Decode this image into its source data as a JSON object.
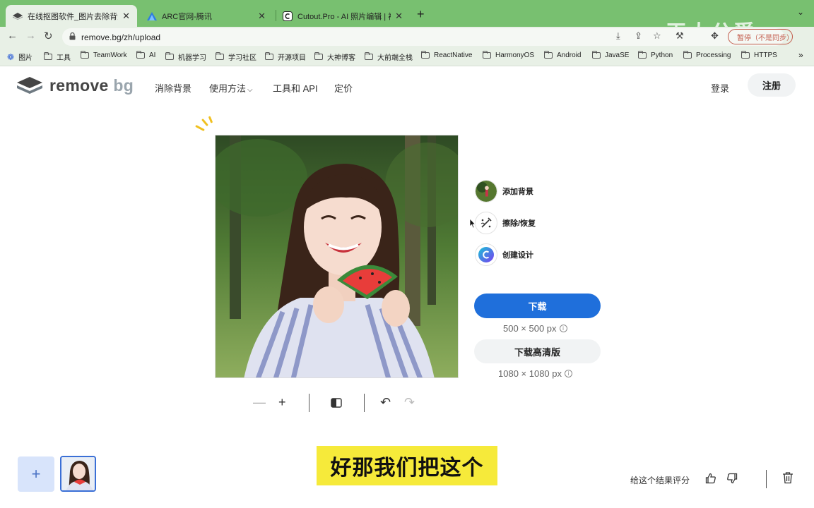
{
  "browser": {
    "tabs": [
      {
        "title": "在线抠图软件_图片去除背景 | re",
        "close": "✕"
      },
      {
        "title": "ARC官网-腾讯",
        "close": "✕"
      },
      {
        "title": "Cutout.Pro - AI 照片编辑 | 视",
        "close": "✕"
      }
    ],
    "new_tab": "+",
    "url": "remove.bg/zh/upload",
    "paused_label": "暂停（不是同步）",
    "watermark": "王大公爵",
    "bookmarks": [
      "图片",
      "工具",
      "TeamWork",
      "AI",
      "机器学习",
      "学习社区",
      "开源项目",
      "大神博客",
      "大前端全栈",
      "ReactNative",
      "HarmonyOS",
      "Android",
      "JavaSE",
      "Python",
      "Processing",
      "HTTPS"
    ],
    "bookmarks_more": "»"
  },
  "site": {
    "logo_main": "remove",
    "logo_bg": "bg",
    "nav": [
      "消除背景",
      "使用方法",
      "工具和 API",
      "定价"
    ],
    "nav_dropdown_icon": "chevron-down-icon",
    "login": "登录",
    "signup": "注册"
  },
  "editor": {
    "actions": [
      {
        "label": "添加背景",
        "icon": "background-thumbnail-icon"
      },
      {
        "label": "擦除/恢复",
        "icon": "magic-brush-icon"
      },
      {
        "label": "创建设计",
        "icon": "canva-icon"
      }
    ],
    "download": "下载",
    "download_size": "500 × 500 px",
    "download_hd": "下载高清版",
    "hd_size": "1080 × 1080 px",
    "tools": {
      "zoom_out": "—",
      "zoom_in": "+"
    }
  },
  "bottom": {
    "add": "+",
    "subtitle": "好那我们把这个",
    "rate_label": "给这个结果评分"
  },
  "colors": {
    "tab_bar": "#78c070",
    "primary_button": "#1f6fdb",
    "subtitle_bg": "#f6ea3a"
  }
}
